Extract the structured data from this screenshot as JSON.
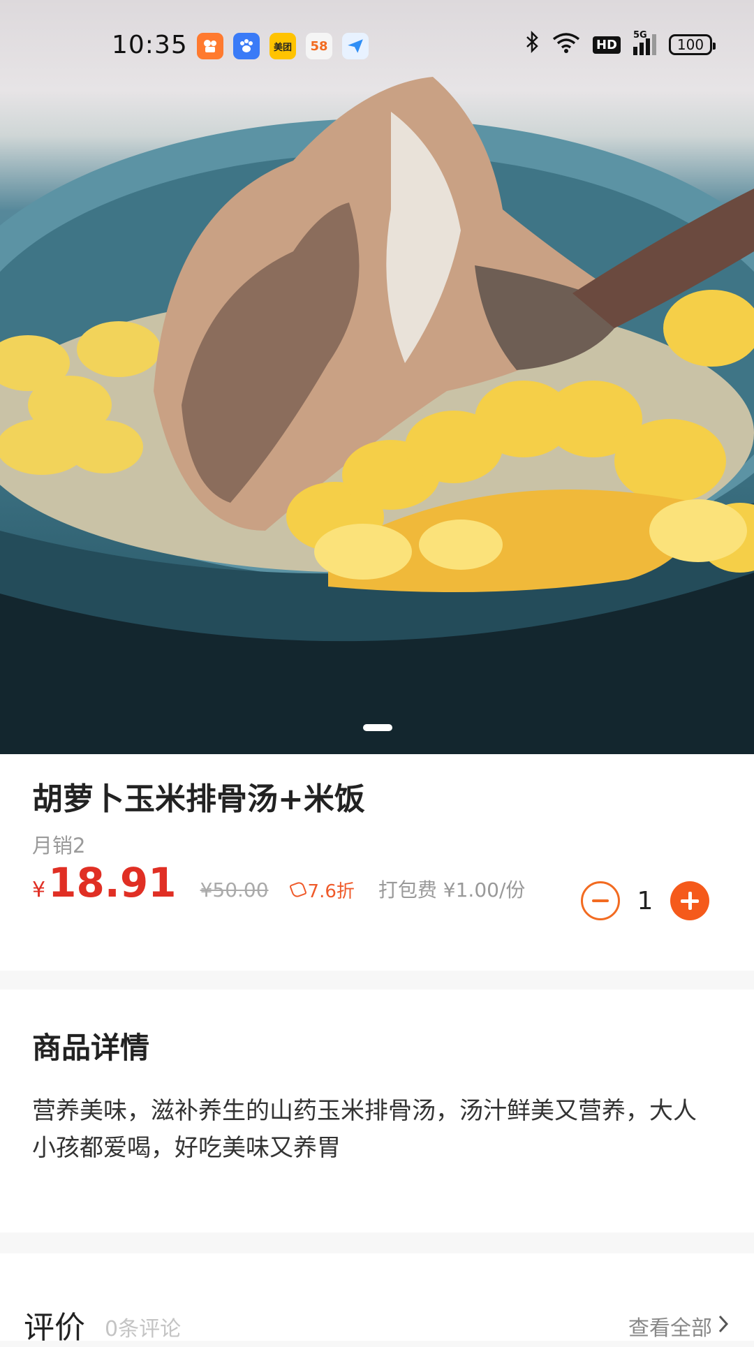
{
  "status_bar": {
    "time": "10:35",
    "notification_icons": [
      {
        "name": "kuaishou-app-icon",
        "label": "",
        "color": "#ff7a2f"
      },
      {
        "name": "baidu-app-icon",
        "label": "",
        "color": "#3a7bf7"
      },
      {
        "name": "meituan-app-icon",
        "label": "美团",
        "color": "#ffc300"
      },
      {
        "name": "58-app-icon",
        "label": "58",
        "color": "#f5f5f5"
      },
      {
        "name": "send-app-icon",
        "label": "",
        "color": "#4aa8ff"
      }
    ],
    "hd_label": "HD",
    "network_label": "5G",
    "battery_level": "100"
  },
  "product": {
    "title": "胡萝卜玉米排骨汤+米饭",
    "monthly_sales": "月销2",
    "price_symbol": "¥",
    "price": "18.91",
    "original_price": "¥50.00",
    "discount": "7.6折",
    "packaging_fee": "打包费 ¥1.00/份",
    "quantity": "1",
    "image_page_count": 1,
    "image_current_page": 1
  },
  "details": {
    "title": "商品详情",
    "description": "营养美味，滋补养生的山药玉米排骨汤，汤汁鲜美又营养，大人小孩都爱喝，好吃美味又养胃"
  },
  "reviews": {
    "title": "评价",
    "count_text": "0条评论",
    "view_all_label": "查看全部"
  },
  "colors": {
    "price_red": "#e02f24",
    "accent_orange": "#f55a1b",
    "discount_orange": "#ef5a2a"
  }
}
